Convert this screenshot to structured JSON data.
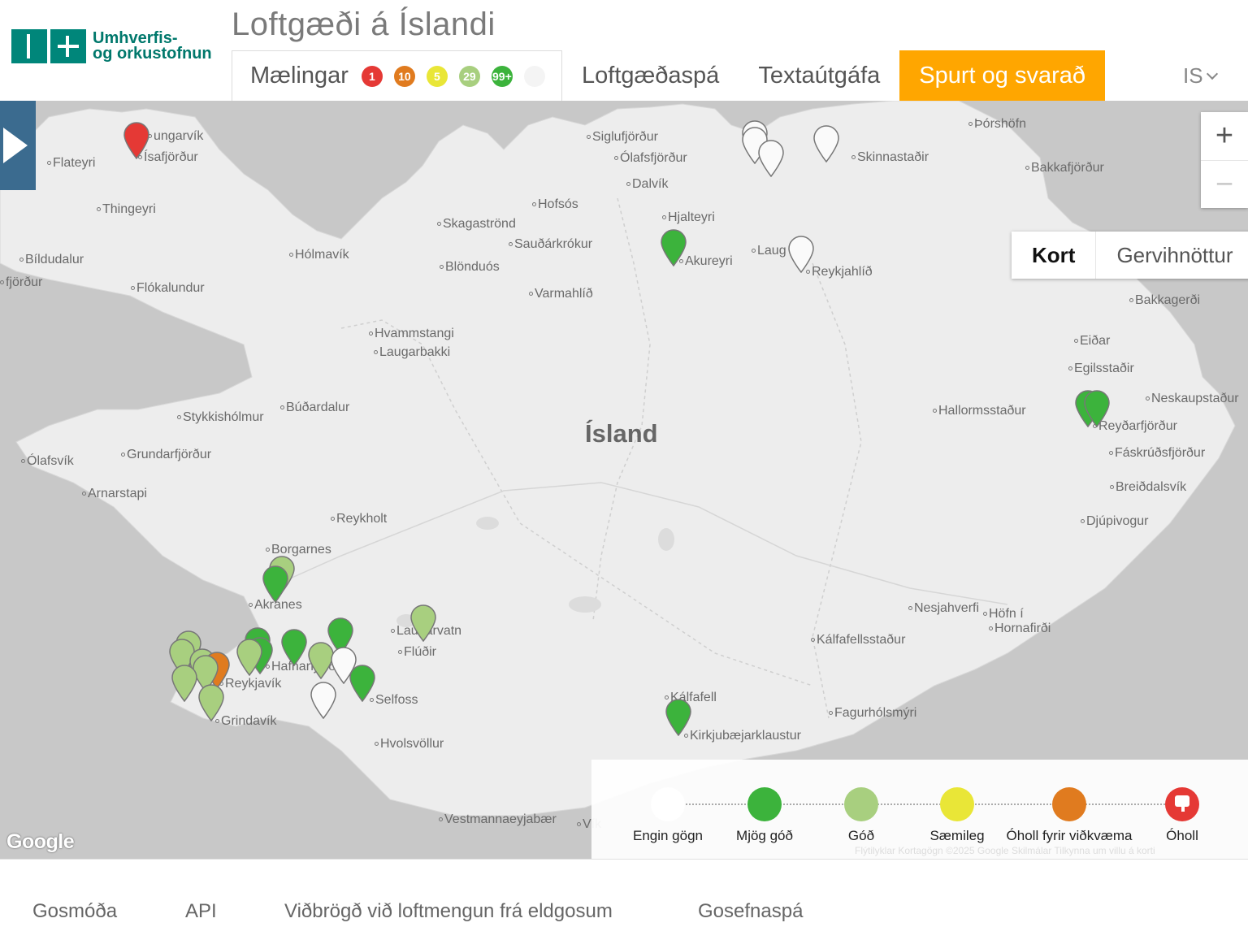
{
  "header": {
    "logo_line1": "Umhverfis-",
    "logo_line2": "og orkustofnun",
    "title": "Loftgæði á Íslandi",
    "tabs": {
      "measurements": "Mælingar",
      "forecast": "Loftgæðaspá",
      "text_version": "Textaútgáfa",
      "faq": "Spurt og svarað"
    },
    "badges": [
      {
        "label": "1",
        "color": "#e53935"
      },
      {
        "label": "10",
        "color": "#e07b1f"
      },
      {
        "label": "5",
        "color": "#e9e637"
      },
      {
        "label": "29",
        "color": "#a8cf7f"
      },
      {
        "label": "99+",
        "color": "#3cb33c"
      },
      {
        "label": "",
        "color": "#f4f4f4"
      }
    ],
    "language": "IS"
  },
  "map": {
    "country_label": "Ísland",
    "zoom_in": "+",
    "zoom_out": "−",
    "map_type": {
      "map": "Kort",
      "satellite": "Gervihnöttur"
    },
    "google": "Google",
    "attribution": "Flýtilyklar    Kortagögn ©2025 Google    Skilmálar    Tilkynna um villu á korti",
    "places": [
      {
        "name": "Þórshöfn"
      },
      {
        "name": "Siglufjörður"
      },
      {
        "name": "Ólafsfjörður"
      },
      {
        "name": "Dalvík"
      },
      {
        "name": "Skinnastaðir"
      },
      {
        "name": "Bakkafjörður"
      },
      {
        "name": "ungarvík"
      },
      {
        "name": "Ísafjörður"
      },
      {
        "name": "Flateyri"
      },
      {
        "name": "Thingeyri"
      },
      {
        "name": "Hofsós"
      },
      {
        "name": "Skagaströnd"
      },
      {
        "name": "Sauðárkrókur"
      },
      {
        "name": "Hjalteyri"
      },
      {
        "name": "Akureyri"
      },
      {
        "name": "Laug"
      },
      {
        "name": "Reykjahlíð"
      },
      {
        "name": "Bíldudalur"
      },
      {
        "name": "Hólmavík"
      },
      {
        "name": "Blönduós"
      },
      {
        "name": "fjörður"
      },
      {
        "name": "Flókalundur"
      },
      {
        "name": "Varmahlíð"
      },
      {
        "name": "Bakkagerði"
      },
      {
        "name": "Eiðar"
      },
      {
        "name": "Egilsstaðir"
      },
      {
        "name": "Hvammstangi"
      },
      {
        "name": "Laugarbakki"
      },
      {
        "name": "Neskaupstaður"
      },
      {
        "name": "Hallormsstaður"
      },
      {
        "name": "Reyðarfjörður"
      },
      {
        "name": "Búðardalur"
      },
      {
        "name": "Stykkishólmur"
      },
      {
        "name": "Fáskrúðsfjörður"
      },
      {
        "name": "Ólafsvík"
      },
      {
        "name": "Grundarfjörður"
      },
      {
        "name": "Breiðdalsvík"
      },
      {
        "name": "Arnarstapi"
      },
      {
        "name": "Reykholt"
      },
      {
        "name": "Djúpivogur"
      },
      {
        "name": "Borgarnes"
      },
      {
        "name": "Akranes"
      },
      {
        "name": "Nesjahverfi"
      },
      {
        "name": "Höfn í"
      },
      {
        "name": "Hornafirði"
      },
      {
        "name": "Laugarvatn"
      },
      {
        "name": "Kálfafellsstaður"
      },
      {
        "name": "Flúðir"
      },
      {
        "name": "Hafnarfjörður"
      },
      {
        "name": "Reykjavík"
      },
      {
        "name": "Selfoss"
      },
      {
        "name": "Grindavík"
      },
      {
        "name": "Kálfafell"
      },
      {
        "name": "Fagurhólsmýri"
      },
      {
        "name": "Kirkjubæjarklaustur"
      },
      {
        "name": "Hvolsvöllur"
      },
      {
        "name": "Vestmannaeyjabær"
      },
      {
        "name": "Vík"
      }
    ],
    "markers": [
      {
        "status": "unhealthy",
        "color": "#e53935"
      },
      {
        "status": "no-data",
        "color": "#fafafa"
      },
      {
        "status": "no-data",
        "color": "#fafafa"
      },
      {
        "status": "no-data",
        "color": "#fafafa"
      },
      {
        "status": "no-data",
        "color": "#fafafa"
      },
      {
        "status": "very-good",
        "color": "#3cb33c"
      },
      {
        "status": "no-data",
        "color": "#fafafa"
      },
      {
        "status": "very-good",
        "color": "#3cb33c"
      },
      {
        "status": "very-good",
        "color": "#3cb33c"
      },
      {
        "status": "good",
        "color": "#a8cf7f"
      },
      {
        "status": "very-good",
        "color": "#3cb33c"
      },
      {
        "status": "good",
        "color": "#a8cf7f"
      },
      {
        "status": "good",
        "color": "#a8cf7f"
      },
      {
        "status": "good",
        "color": "#a8cf7f"
      },
      {
        "status": "unhealthy-sensitive",
        "color": "#e07b1f"
      },
      {
        "status": "good",
        "color": "#a8cf7f"
      },
      {
        "status": "good",
        "color": "#a8cf7f"
      },
      {
        "status": "good",
        "color": "#a8cf7f"
      },
      {
        "status": "very-good",
        "color": "#3cb33c"
      },
      {
        "status": "very-good",
        "color": "#3cb33c"
      },
      {
        "status": "very-good",
        "color": "#3cb33c"
      },
      {
        "status": "good",
        "color": "#a8cf7f"
      },
      {
        "status": "very-good",
        "color": "#3cb33c"
      },
      {
        "status": "good",
        "color": "#a8cf7f"
      },
      {
        "status": "no-data",
        "color": "#fafafa"
      },
      {
        "status": "very-good",
        "color": "#3cb33c"
      },
      {
        "status": "no-data",
        "color": "#fafafa"
      },
      {
        "status": "good",
        "color": "#a8cf7f"
      },
      {
        "status": "very-good",
        "color": "#3cb33c"
      }
    ]
  },
  "legend": [
    {
      "label": "Engin gögn",
      "color": "#ffffff"
    },
    {
      "label": "Mjög góð",
      "color": "#3cb33c"
    },
    {
      "label": "Góð",
      "color": "#a8cf7f"
    },
    {
      "label": "Sæmileg",
      "color": "#e9e637"
    },
    {
      "label": "Óholl fyrir viðkvæma",
      "color": "#e07b1f"
    },
    {
      "label": "Óholl",
      "color": "#e53935"
    }
  ],
  "footer": {
    "links": [
      "Gosmóða",
      "API",
      "Viðbrögð við loftmengun frá eldgosum",
      "Gosefnaspá"
    ]
  }
}
